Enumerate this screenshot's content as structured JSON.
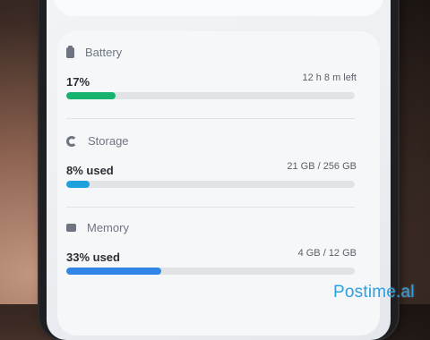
{
  "sections": [
    {
      "id": "battery",
      "label": "Battery",
      "icon": "battery-icon",
      "primary": "17%",
      "secondary": "12 h 8 m left",
      "fraction": 0.17,
      "color": "#16b36e"
    },
    {
      "id": "storage",
      "label": "Storage",
      "icon": "storage-icon",
      "primary": "8% used",
      "secondary": "21 GB / 256 GB",
      "fraction": 0.08,
      "color": "#1fa2dc"
    },
    {
      "id": "memory",
      "label": "Memory",
      "icon": "memory-icon",
      "primary": "33% used",
      "secondary": "4 GB / 12 GB",
      "fraction": 0.33,
      "color": "#2f86e6"
    }
  ],
  "watermark": "Postime.al"
}
